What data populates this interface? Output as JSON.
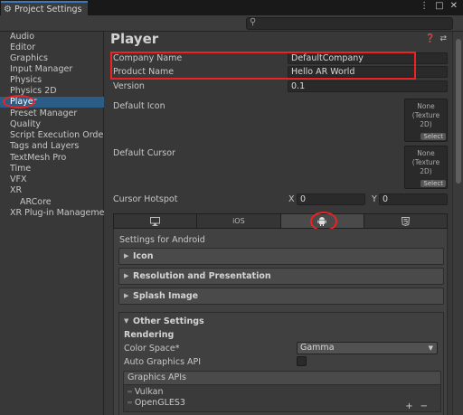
{
  "window": {
    "tab_title": "Project Settings",
    "controls": [
      "more-icon",
      "maximize-icon",
      "close-icon"
    ]
  },
  "search": {
    "placeholder": ""
  },
  "sidebar": {
    "items": [
      {
        "label": "Audio"
      },
      {
        "label": "Editor"
      },
      {
        "label": "Graphics"
      },
      {
        "label": "Input Manager"
      },
      {
        "label": "Physics"
      },
      {
        "label": "Physics 2D"
      },
      {
        "label": "Player",
        "selected": true
      },
      {
        "label": "Preset Manager"
      },
      {
        "label": "Quality"
      },
      {
        "label": "Script Execution Order"
      },
      {
        "label": "Tags and Layers"
      },
      {
        "label": "TextMesh Pro"
      },
      {
        "label": "Time"
      },
      {
        "label": "VFX"
      },
      {
        "label": "XR",
        "expanded": true
      },
      {
        "label": "ARCore",
        "child": true
      },
      {
        "label": "XR Plug-in Managemen"
      }
    ]
  },
  "main": {
    "title": "Player",
    "company_name_label": "Company Name",
    "company_name_value": "DefaultCompany",
    "product_name_label": "Product Name",
    "product_name_value": "Hello AR World",
    "version_label": "Version",
    "version_value": "0.1",
    "default_icon_label": "Default Icon",
    "default_cursor_label": "Default Cursor",
    "texture_none": "None",
    "texture_type": "(Texture 2D)",
    "select_label": "Select",
    "cursor_hotspot_label": "Cursor Hotspot",
    "hotspot_x_label": "X",
    "hotspot_x_value": "0",
    "hotspot_y_label": "Y",
    "hotspot_y_value": "0",
    "platform_tabs": [
      {
        "label": "",
        "icon": "monitor-icon"
      },
      {
        "label": "iOS",
        "icon": ""
      },
      {
        "label": "",
        "icon": "android-icon",
        "active": true
      },
      {
        "label": "",
        "icon": "html5-icon"
      }
    ],
    "settings_for": "Settings for Android",
    "sections": {
      "icon": "Icon",
      "resolution": "Resolution and Presentation",
      "splash": "Splash Image",
      "other": "Other Settings"
    },
    "rendering_label": "Rendering",
    "color_space_label": "Color Space*",
    "color_space_value": "Gamma",
    "auto_graphics_label": "Auto Graphics API",
    "auto_graphics_checked": false,
    "graphics_apis_label": "Graphics APIs",
    "graphics_apis": [
      "Vulkan",
      "OpenGLES3"
    ],
    "add_button": "+",
    "remove_button": "−"
  },
  "colors": {
    "highlight": "#ee2222",
    "selection": "#2c5d87",
    "tab_accent": "#3a79bb"
  }
}
